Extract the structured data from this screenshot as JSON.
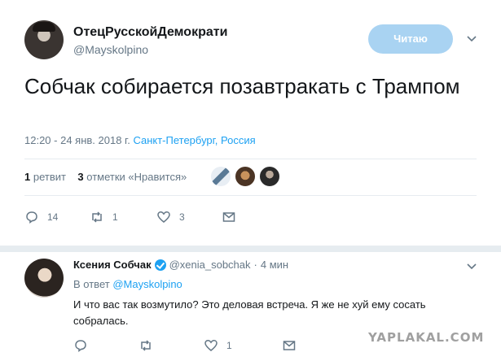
{
  "tweet": {
    "author_name": "ОтецРусскойДемократи",
    "author_handle": "@Mayskolpino",
    "follow_button_label": "Читаю",
    "text": "Собчак собирается позавтракать с Трампом",
    "timestamp": "12:20 - 24 янв. 2018 г.",
    "location": "Санкт-Петербург, Россия",
    "retweets_count": "1",
    "retweets_label": "ретвит",
    "likes_count": "3",
    "likes_label": "отметки «Нравится»",
    "actions": {
      "reply_count": "14",
      "retweet_count": "1",
      "like_count": "3"
    },
    "icons": [
      "reply-icon",
      "retweet-icon",
      "heart-icon",
      "message-icon",
      "chevron-down-icon"
    ]
  },
  "reply": {
    "author_name": "Ксения Собчак",
    "author_handle": "@xenia_sobchak",
    "time": "4 мин",
    "separator": "·",
    "in_reply_prefix": "В ответ",
    "in_reply_handle": "@Mayskolpino",
    "text": "И что вас так возмутило? Это деловая встреча. Я же не хуй ему сосать собралась.",
    "actions": {
      "like_count": "1"
    }
  },
  "watermark": "YAPLAKAL.COM",
  "colors": {
    "accent": "#1da1f2",
    "follow_button": "#a9d3f2",
    "muted_text": "#657786",
    "divider": "#e6ecf0"
  }
}
